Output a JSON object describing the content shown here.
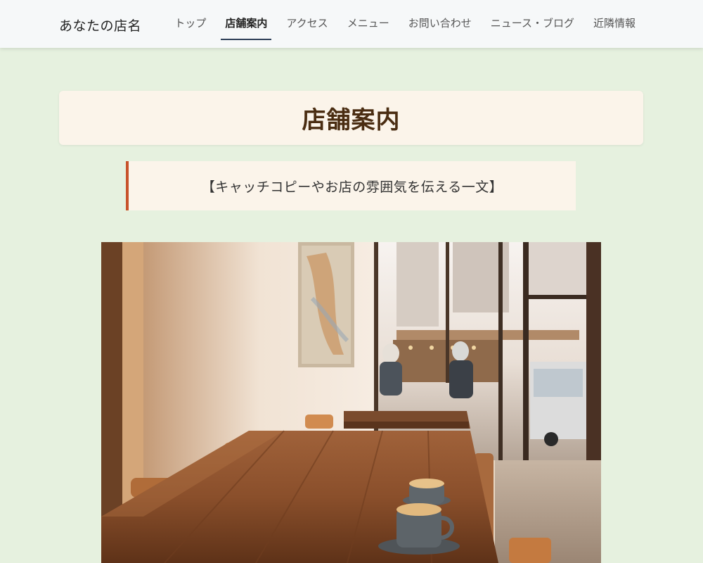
{
  "header": {
    "brand": "あなたの店名",
    "nav": [
      {
        "label": "トップ",
        "active": false
      },
      {
        "label": "店舗案内",
        "active": true
      },
      {
        "label": "アクセス",
        "active": false
      },
      {
        "label": "メニュー",
        "active": false
      },
      {
        "label": "お問い合わせ",
        "active": false
      },
      {
        "label": "ニュース・ブログ",
        "active": false
      },
      {
        "label": "近隣情報",
        "active": false
      }
    ]
  },
  "main": {
    "title": "店舗案内",
    "catchcopy": "【キャッチコピーやお店の雰囲気を伝える一文】"
  },
  "colors": {
    "background": "#e6f1df",
    "header_bg": "#f6f8f9",
    "card_bg": "#fbf4ea",
    "accent": "#c8532b",
    "active_underline": "#2d3e57",
    "title_color": "#4a2d12"
  }
}
